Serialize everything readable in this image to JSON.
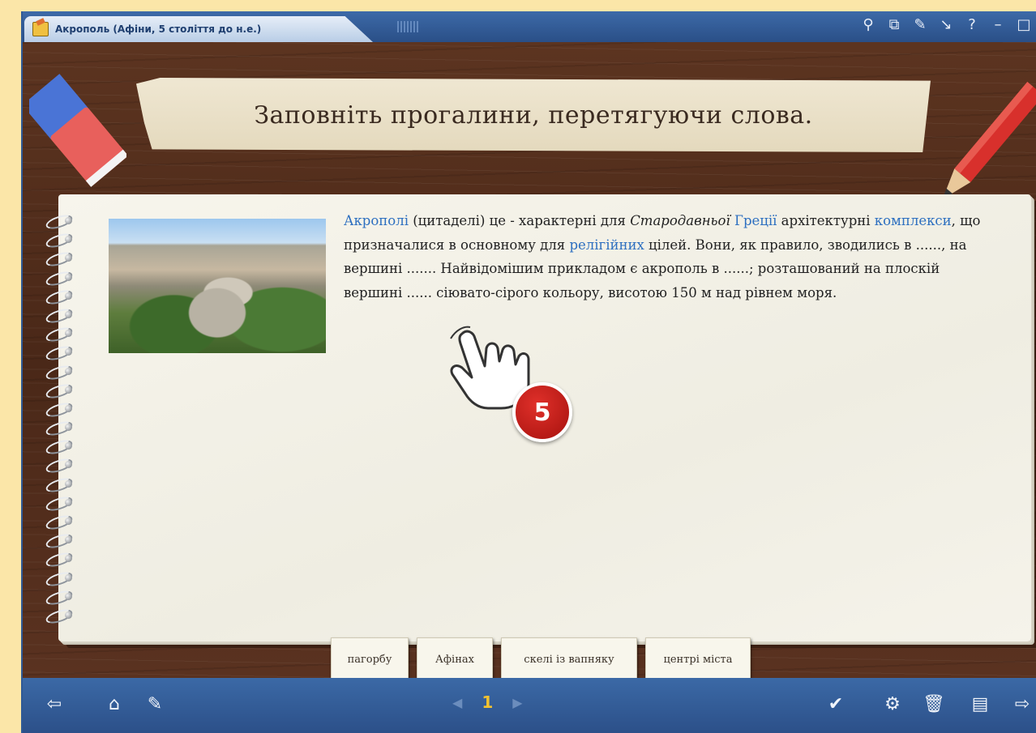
{
  "window": {
    "title": "Акрополь (Афіни, 5 століття до н.е.)",
    "controls": [
      "⚲",
      "⧉",
      "✎",
      "↘",
      "?",
      "–",
      "□"
    ]
  },
  "task": {
    "instruction": "Заповніть прогалини, перетягуючи слова."
  },
  "content": {
    "image_alt": "Aerial photo of Acropolis hill",
    "text_parts": {
      "t1": "Акрополі",
      "t2": " (цитаделі) це - характерні для ",
      "t3": "Стародавньої",
      "t4": " ",
      "t5": "Греції",
      "t6": " архітектурні ",
      "t7": "комплекси",
      "t8": ", що призначалися в основному для ",
      "t9": "релігійних",
      "t10": " цілей. Вони, як правило, зводились в ......, на вершині ....... Найвідомішим прикладом є акрополь в ......; розташований на плоскій вершині ...... сіювато-сірого кольору, висотою 150 м над рівнем моря."
    }
  },
  "callout": {
    "number": "5"
  },
  "word_bank": [
    "пагорбу",
    "Афінах",
    "скелі із вапняку",
    "центрі міста"
  ],
  "toolbar": {
    "page": "1",
    "left_icons": [
      "exit-icon",
      "home-icon",
      "edit-icon"
    ],
    "right_icons": [
      "check-icon",
      "settings-icon",
      "trash-icon",
      "notes-icon",
      "export-icon"
    ]
  }
}
